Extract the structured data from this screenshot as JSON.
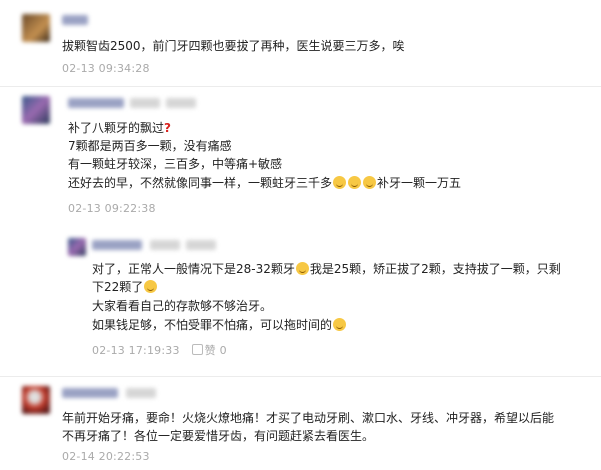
{
  "comments": [
    {
      "user": "",
      "text_lines": [
        "拔颗智齿2500，前门牙四颗也要拔了再种，医生说要三万多，唉"
      ],
      "time": "02-13 09:34:28"
    },
    {
      "user": "",
      "text_lines": [
        "补了八颗牙的飘过",
        "7颗都是两百多一颗，没有痛感",
        "有一颗蛀牙较深，三百多，中等痛+敏感",
        "还好去的早，不然就像同事一样，一颗蛀牙三千多",
        "补牙一颗一万五"
      ],
      "time": "02-13 09:22:38",
      "reply": {
        "user": "",
        "text_lines": [
          "对了，正常人一般情况下是28-32颗牙",
          "我是25颗，矫正拔了2颗，支持拔了一颗，只剩",
          "下22颗了",
          "大家看看自己的存款够不够治牙。",
          "如果钱足够，不怕受罪不怕痛，可以拖时间的"
        ],
        "time": "02-13 17:19:33",
        "like_label": "赞",
        "like_count": "0"
      }
    },
    {
      "user": "",
      "text_lines": [
        "年前开始牙痛，要命！火烧火燎地痛！才买了电动牙刷、漱口水、牙线、冲牙器，希望以后能",
        "不再牙痛了！各位一定要爱惜牙齿，有问题赶紧去看医生。"
      ],
      "time": "02-14 20:22:53"
    }
  ],
  "colors": {
    "name": "#6b7ab0",
    "meta": "#aaaaaa",
    "divider": "#ececec"
  }
}
